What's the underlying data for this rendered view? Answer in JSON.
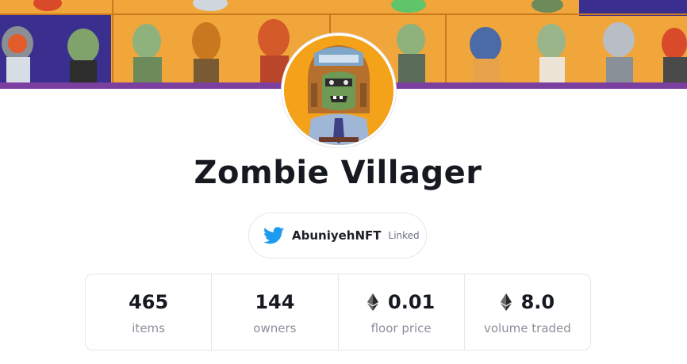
{
  "collection": {
    "name": "Zombie Villager"
  },
  "social": {
    "icon": "twitter-icon",
    "handle": "AbuniyehNFT",
    "status": "Linked",
    "brand_color": "#1d9bf0"
  },
  "stats": [
    {
      "value": "465",
      "label": "items",
      "currency_icon": null
    },
    {
      "value": "144",
      "label": "owners",
      "currency_icon": null
    },
    {
      "value": "0.01",
      "label": "floor price",
      "currency_icon": "ethereum-icon"
    },
    {
      "value": "8.0",
      "label": "volume traded",
      "currency_icon": "ethereum-icon"
    }
  ],
  "colors": {
    "banner_background": "#f0a63a",
    "banner_bottom_stripe": "#7b3fa0",
    "avatar_background": "#f4a21a",
    "title_text": "#16191f",
    "muted_text": "#8a8f99"
  }
}
